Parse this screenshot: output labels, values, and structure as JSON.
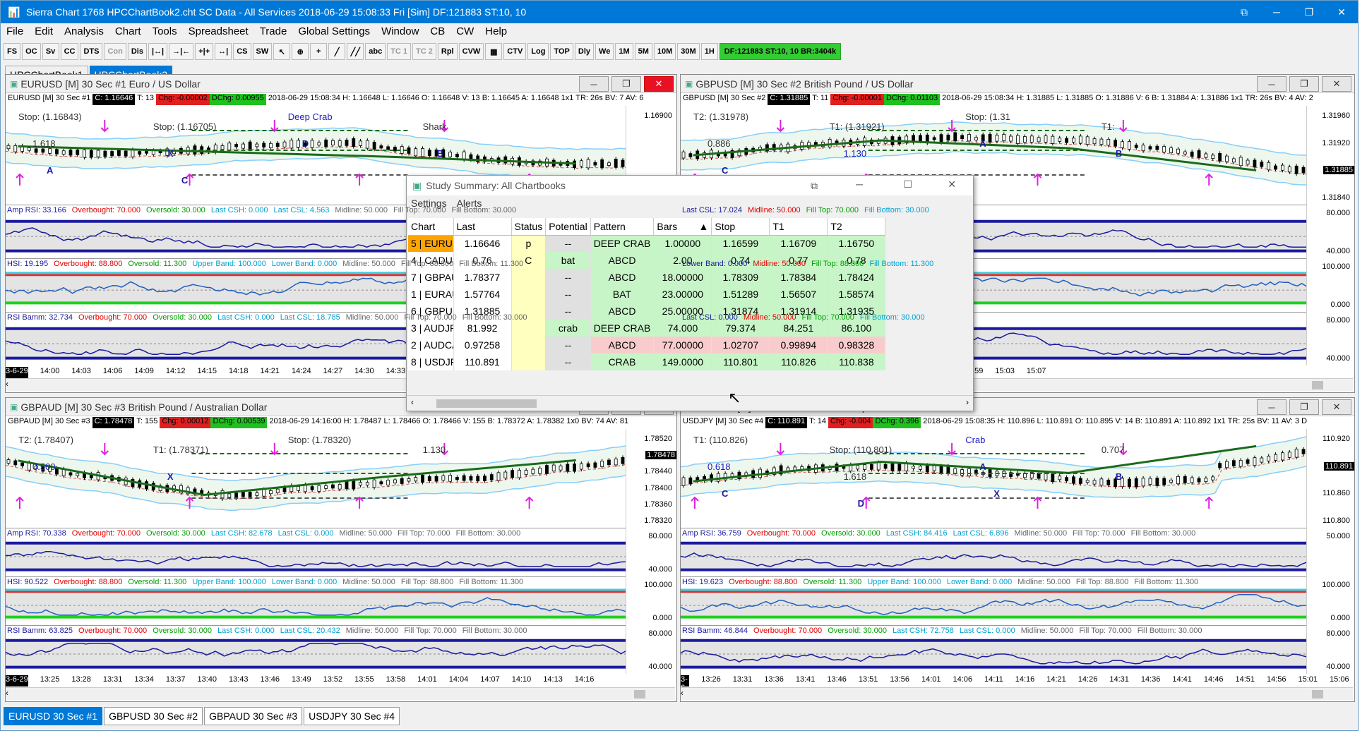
{
  "window": {
    "title": "Sierra Chart 1768 HPCChartBook2.cht  SC Data - All Services 2018-06-29  15:08:33 Fri [Sim]  DF:121883  ST:10, 10"
  },
  "menu": [
    "File",
    "Edit",
    "Analysis",
    "Chart",
    "Tools",
    "Spreadsheet",
    "Trade",
    "Global Settings",
    "Window",
    "CB",
    "CW",
    "Help"
  ],
  "toolbar": [
    "FS",
    "OC",
    "Sv",
    "CC",
    "DTS",
    "Con",
    "Dis",
    "|↔|",
    "→|←",
    "+|+",
    "↔|",
    "CS",
    "SW",
    "↖",
    "⊕",
    "+",
    "╱",
    "╱╱",
    "abc",
    "TC 1",
    "TC 2",
    "Rpl",
    "CVW",
    "▦",
    "CTV",
    "Log",
    "TOP",
    "Dly",
    "We",
    "1M",
    "5M",
    "10M",
    "30M",
    "1H"
  ],
  "toolbar_status": "DF:121883  ST:10, 10  BR:3404k",
  "chartbook_tabs": [
    "HPCChartBook1",
    "HPCChartBook2"
  ],
  "bottom_tabs": [
    "EURUSD  30 Sec  #1",
    "GBPUSD  30 Sec  #2",
    "GBPAUD  30 Sec  #3",
    "USDJPY  30 Sec  #4"
  ],
  "charts": [
    {
      "title": "EURUSD [M]  30 Sec   #1  Euro / US Dollar",
      "info": {
        "sym": "EURUSD [M]   30 Sec  #1",
        "c": "C: 1.16646",
        "t": "T: 13",
        "chg": "Chg: -0.00002",
        "dchg": "DChg: 0.00955",
        "rest": "2018-06-29  15:08:34 H: 1.16648 L: 1.16646 O: 1.16648 V: 13 B: 1.16645 A: 1.16648 1x1 TR: 26s BV: 7 AV: 6"
      },
      "scale": [
        "1.16900",
        "1.16800"
      ],
      "current": "",
      "sub": [
        {
          "label": [
            "Amp RSI: 33.166",
            "Overbought: 70.000",
            "Oversold: 30.000",
            "Last CSH: 0.000",
            "Last CSL: 4.563",
            "Midline: 50.000",
            "Fill Top: 70.000",
            "Fill Bottom: 30.000"
          ],
          "scale": []
        },
        {
          "label": [
            "HSI: 19.195",
            "Overbought: 88.800",
            "Oversold: 11.300",
            "Upper Band: 100.000",
            "Lower Band: 0.000",
            "Midline: 50.000",
            "Fill Top: 88.800",
            "Fill Bottom: 11.300"
          ],
          "scale": []
        },
        {
          "label": [
            "RSI Bamm: 32.734",
            "Overbought: 70.000",
            "Oversold: 30.000",
            "Last CSH: 0.000",
            "Last CSL: 18.785",
            "Midline: 50.000",
            "Fill Top: 70.000",
            "Fill Bottom: 30.000"
          ],
          "scale": []
        }
      ],
      "time": [
        "3-6-29",
        "14:00",
        "14:03",
        "14:06",
        "14:09",
        "14:12",
        "14:15",
        "14:18",
        "14:21",
        "14:24",
        "14:27",
        "14:30",
        "14:33",
        "14:36",
        "14:39"
      ],
      "ann": {
        "stop": "Stop: (1.16843)",
        "stop2": "Stop: (1.16705)",
        "pattern": "Deep Crab",
        "shark": "Shark",
        "fib": "1.618",
        "x": "X",
        "d": "D",
        "b": "B",
        "a": "A",
        "c": "C"
      }
    },
    {
      "title": "GBPUSD [M]  30 Sec   #2  British Pound / US Dollar",
      "info": {
        "sym": "GBPUSD [M]   30 Sec  #2",
        "c": "C: 1.31885",
        "t": "T: 11",
        "chg": "Chg: -0.00001",
        "dchg": "DChg: 0.01103",
        "rest": "2018-06-29  15:08:34 H: 1.31885 L: 1.31885 O: 1.31886 V: 6 B: 1.31884 A: 1.31886 1x1 TR: 26s BV: 4 AV: 2"
      },
      "scale": [
        "1.31960",
        "1.31920",
        "1.31885",
        "1.31840"
      ],
      "current": "1.31885",
      "sub": [
        {
          "label": [
            "Last CSL: 17.024",
            "Midline: 50.000",
            "Fill Top: 70.000",
            "Fill Bottom: 30.000"
          ],
          "scale": [
            "80.000",
            "40.000"
          ]
        },
        {
          "label": [
            "Lower Band: 0.000",
            "Midline: 50.000",
            "Fill Top: 88.800",
            "Fill Bottom: 11.300"
          ],
          "scale": [
            "100.000",
            "0.000"
          ]
        },
        {
          "label": [
            "Last CSL: 0.000",
            "Midline: 50.000",
            "Fill Top: 70.000",
            "Fill Bottom: 30.000"
          ],
          "scale": [
            "80.000",
            "40.000"
          ]
        }
      ],
      "time": [
        "14:23",
        "14:27",
        "14:31",
        "14:35",
        "14:39",
        "14:43",
        "14:47",
        "14:51",
        "14:55",
        "14:59",
        "15:03",
        "15:07"
      ],
      "ann": {
        "t2": "T2: (1.31978)",
        "t1": "T1: (1.31921)",
        "stop": "Stop: (1.31",
        "t1r": "T1:",
        "fib": "0.886",
        "fib2": "1.130",
        "a": "A",
        "b": "B",
        "c": "C",
        "d": "D"
      }
    },
    {
      "title": "GBPAUD [M]  30 Sec   #3  British Pound / Australian Dollar",
      "info": {
        "sym": "GBPAUD [M]   30 Sec  #3",
        "c": "C: 1.78478",
        "t": "T: 155",
        "chg": "Chg: 0.00012",
        "dchg": "DChg: 0.00539",
        "rest": "2018-06-29  14:16:00 H: 1.78487 L: 1.78466 O: 1.78466 V: 155 B: 1.78372 A: 1.78382 1x0 BV: 74 AV: 81"
      },
      "scale": [
        "1.78520",
        "1.78478",
        "1.78440",
        "1.78400",
        "1.78360",
        "1.78320"
      ],
      "current": "1.78478",
      "sub": [
        {
          "label": [
            "Amp RSI: 70.338",
            "Overbought: 70.000",
            "Oversold: 30.000",
            "Last CSH: 82.678",
            "Last CSL: 0.000",
            "Midline: 50.000",
            "Fill Top: 70.000",
            "Fill Bottom: 30.000"
          ],
          "scale": [
            "80.000",
            "40.000"
          ]
        },
        {
          "label": [
            "HSI: 90.522",
            "Overbought: 88.800",
            "Oversold: 11.300",
            "Upper Band: 100.000",
            "Lower Band: 0.000",
            "Midline: 50.000",
            "Fill Top: 88.800",
            "Fill Bottom: 11.300"
          ],
          "scale": [
            "100.000",
            "0.000"
          ]
        },
        {
          "label": [
            "RSI Bamm: 63.825",
            "Overbought: 70.000",
            "Oversold: 30.000",
            "Last CSH: 0.000",
            "Last CSL: 20.432",
            "Midline: 50.000",
            "Fill Top: 70.000",
            "Fill Bottom: 30.000"
          ],
          "scale": [
            "80.000",
            "40.000"
          ]
        }
      ],
      "time": [
        "3-6-29",
        "13:25",
        "13:28",
        "13:31",
        "13:34",
        "13:37",
        "13:40",
        "13:43",
        "13:46",
        "13:49",
        "13:52",
        "13:55",
        "13:58",
        "14:01",
        "14:04",
        "14:07",
        "14:10",
        "14:13",
        "14:16"
      ],
      "ann": {
        "t2": "T2: (1.78407)",
        "t1": "T1: (1.78371)",
        "stop": "Stop: (1.78320)",
        "fib": "1.130",
        "fib2": "0.500",
        "x": "X"
      }
    },
    {
      "title": "USDJPY [M]  30 Sec   #4  US Dollar / Japanese Yen",
      "info": {
        "sym": "USDJPY [M]   30 Sec  #4",
        "c": "C: 110.891",
        "t": "T: 14",
        "chg": "Chg: -0.004",
        "dchg": "DChg: 0.396",
        "rest": "2018-06-29  15:08:35 H: 110.896 L: 110.891 O: 110.895 V: 14 B: 110.891 A: 110.892 1x1 TR: 25s BV: 11 AV: 3 D"
      },
      "scale": [
        "110.920",
        "110.891",
        "110.860",
        "110.800"
      ],
      "current": "110.891",
      "sub": [
        {
          "label": [
            "Amp RSI: 36.759",
            "Overbought: 70.000",
            "Oversold: 30.000",
            "Last CSH: 84.416",
            "Last CSL: 6.896",
            "Midline: 50.000",
            "Fill Top: 70.000",
            "Fill Bottom: 30.000"
          ],
          "scale": [
            "50.000"
          ]
        },
        {
          "label": [
            "HSI: 19.623",
            "Overbought: 88.800",
            "Oversold: 11.300",
            "Upper Band: 100.000",
            "Lower Band: 0.000",
            "Midline: 50.000",
            "Fill Top: 88.800",
            "Fill Bottom: 11.300"
          ],
          "scale": [
            "100.000",
            "0.000"
          ]
        },
        {
          "label": [
            "RSI Bamm: 46.844",
            "Overbought: 70.000",
            "Oversold: 30.000",
            "Last CSH: 72.758",
            "Last CSL: 0.000",
            "Midline: 50.000",
            "Fill Top: 70.000",
            "Fill Bottom: 30.000"
          ],
          "scale": [
            "80.000",
            "40.000"
          ]
        }
      ],
      "time": [
        "3-6-29",
        "13:26",
        "13:31",
        "13:36",
        "13:41",
        "13:46",
        "13:51",
        "13:56",
        "14:01",
        "14:06",
        "14:11",
        "14:16",
        "14:21",
        "14:26",
        "14:31",
        "14:36",
        "14:41",
        "14:46",
        "14:51",
        "14:56",
        "15:01",
        "15:06"
      ],
      "ann": {
        "t1": "T1: (110.826)",
        "stop": "Stop: (110.801)",
        "pattern": "Crab",
        "fib": "0.707",
        "fib2": "0.618",
        "fib3": "1.618",
        "a": "A",
        "b": "B",
        "c": "C",
        "d": "D",
        "x": "X"
      }
    }
  ],
  "study_summary": {
    "title": "Study Summary:  All Chartbooks",
    "menu": [
      "Settings",
      "Alerts"
    ],
    "columns": [
      "Chart",
      "Last",
      "Status",
      "Potential",
      "Pattern",
      "Bars",
      "Stop",
      "T1",
      "T2"
    ],
    "sort_indicator": "▲",
    "rows": [
      {
        "chart": "5 | EURUSD",
        "last": "1.16646",
        "status": "p",
        "potential": "--",
        "pattern": "DEEP CRAB",
        "bars": "1.00000",
        "stop": "1.16599",
        "t1": "1.16709",
        "t2": "1.16750",
        "bg": "#c8f5c8",
        "chartbg": "#ffa500"
      },
      {
        "chart": "4 | CADUSD",
        "last": "0.76",
        "status": "C",
        "potential": "bat",
        "pattern": "ABCD",
        "bars": "2.00",
        "stop": "0.74",
        "t1": "0.77",
        "t2": "0.78",
        "bg": "#c8f5c8",
        "chartbg": ""
      },
      {
        "chart": "7 | GBPAUD",
        "last": "1.78377",
        "status": "",
        "potential": "--",
        "pattern": "ABCD",
        "bars": "18.00000",
        "stop": "1.78309",
        "t1": "1.78384",
        "t2": "1.78424",
        "bg": "#c8f5c8",
        "chartbg": ""
      },
      {
        "chart": "1 | EURAUD",
        "last": "1.57764",
        "status": "",
        "potential": "--",
        "pattern": "BAT",
        "bars": "23.00000",
        "stop": "1.51289",
        "t1": "1.56507",
        "t2": "1.58574",
        "bg": "#c8f5c8",
        "chartbg": ""
      },
      {
        "chart": "6 | GBPUSD",
        "last": "1.31885",
        "status": "",
        "potential": "--",
        "pattern": "ABCD",
        "bars": "25.00000",
        "stop": "1.31874",
        "t1": "1.31914",
        "t2": "1.31935",
        "bg": "#c8f5c8",
        "chartbg": ""
      },
      {
        "chart": "3 | AUDJPY",
        "last": "81.992",
        "status": "",
        "potential": "crab",
        "pattern": "DEEP CRAB",
        "bars": "74.000",
        "stop": "79.374",
        "t1": "84.251",
        "t2": "86.100",
        "bg": "#c8f5c8",
        "chartbg": ""
      },
      {
        "chart": "2 | AUDCAD",
        "last": "0.97258",
        "status": "",
        "potential": "--",
        "pattern": "ABCD",
        "bars": "77.00000",
        "stop": "1.02707",
        "t1": "0.99894",
        "t2": "0.98328",
        "bg": "#f8cccc",
        "chartbg": ""
      },
      {
        "chart": "8 | USDJPY",
        "last": "110.891",
        "status": "",
        "potential": "--",
        "pattern": "CRAB",
        "bars": "149.0000",
        "stop": "110.801",
        "t1": "110.826",
        "t2": "110.838",
        "bg": "#c8f5c8",
        "chartbg": ""
      }
    ]
  },
  "colors": {
    "accent": "#0078d7",
    "status_green": "#33cc33",
    "rsi_line": "#1a1aa0",
    "band_blue": "#87cefa",
    "ma_green": "#1a6b1a"
  }
}
